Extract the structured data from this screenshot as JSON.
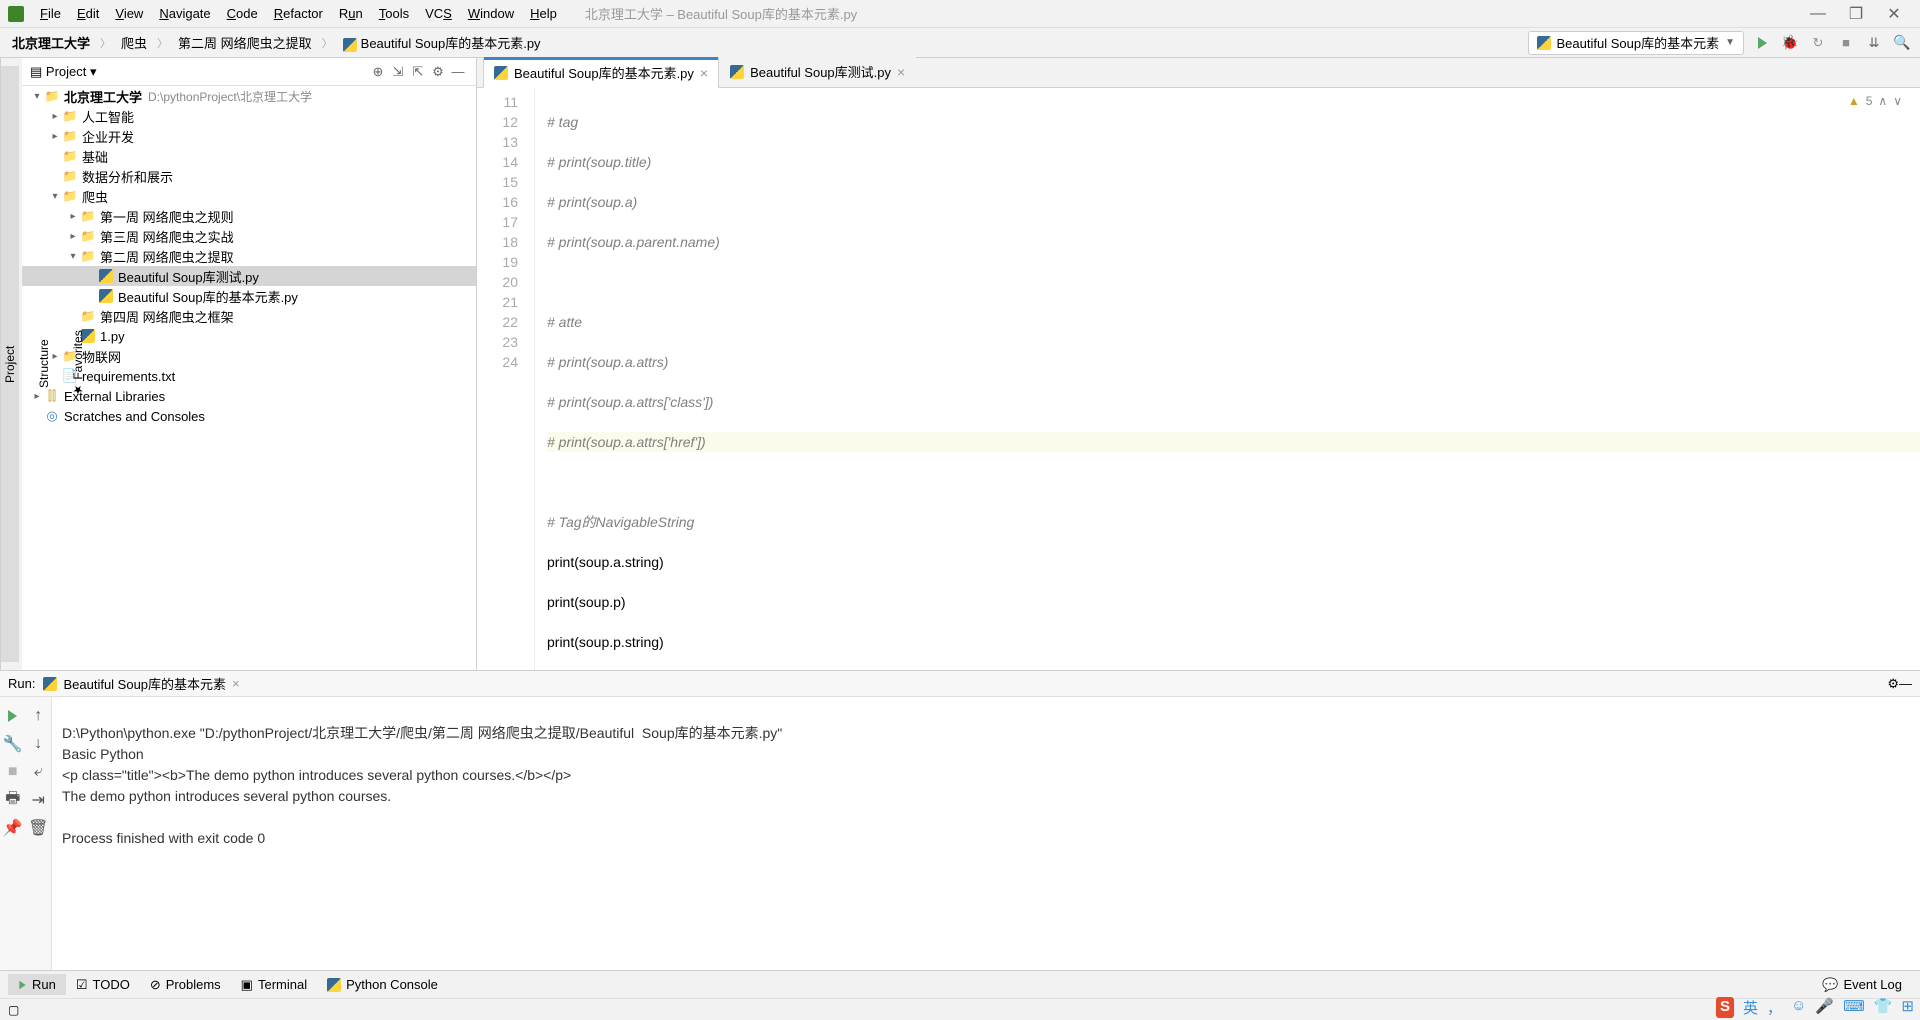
{
  "window": {
    "title": "北京理工大学 – Beautiful  Soup库的基本元素.py",
    "minimize": "—",
    "maximize": "❐",
    "close": "✕"
  },
  "menu": {
    "file": "File",
    "edit": "Edit",
    "view": "View",
    "navigate": "Navigate",
    "code": "Code",
    "refactor": "Refactor",
    "run": "Run",
    "tools": "Tools",
    "vcs": "VCS",
    "window": "Window",
    "help": "Help"
  },
  "breadcrumb": {
    "b0": "北京理工大学",
    "b1": "爬虫",
    "b2": "第二周 网络爬虫之提取",
    "b3": "Beautiful  Soup库的基本元素.py"
  },
  "run_config": {
    "label": "Beautiful  Soup库的基本元素"
  },
  "left_rail": {
    "project": "Project",
    "structure": "Structure",
    "favorites": "Favorites"
  },
  "project_panel": {
    "title": "Project"
  },
  "tree": {
    "root": "北京理工大学",
    "root_path": "D:\\pythonProject\\北京理工大学",
    "n0": "人工智能",
    "n1": "企业开发",
    "n2": "基础",
    "n3": "数据分析和展示",
    "n4": "爬虫",
    "n4a": "第一周 网络爬虫之规则",
    "n4b": "第三周 网络爬虫之实战",
    "n4c": "第二周 网络爬虫之提取",
    "n4c1": "Beautiful Soup库测试.py",
    "n4c2": "Beautiful  Soup库的基本元素.py",
    "n4d": "第四周 网络爬虫之框架",
    "n4e": "1.py",
    "n5": "物联网",
    "n6": "requirements.txt",
    "ext": "External Libraries",
    "scratch": "Scratches and Consoles"
  },
  "tabs": {
    "t0": "Beautiful  Soup库的基本元素.py",
    "t1": "Beautiful Soup库测试.py"
  },
  "editor": {
    "warnings": "5",
    "lines": {
      "l11": "11",
      "c11": "# tag",
      "l12": "12",
      "c12": "# print(soup.title)",
      "l13": "13",
      "c13": "# print(soup.a)",
      "l14": "14",
      "c14": "# print(soup.a.parent.name)",
      "l15": "15",
      "c15": "",
      "l16": "16",
      "c16": "# atte",
      "l17": "17",
      "c17": "# print(soup.a.attrs)",
      "l18": "18",
      "c18": "# print(soup.a.attrs['class'])",
      "l19": "19",
      "c19": "# print(soup.a.attrs['href'])",
      "l20": "20",
      "c20": "",
      "l21": "21",
      "c21": "# Tag的NavigableString",
      "l22": "22",
      "c22_a": "print",
      "c22_b": "(soup.a.string)",
      "l23": "23",
      "c23_a": "print",
      "c23_b": "(soup.p)",
      "l24": "24",
      "c24_a": "print",
      "c24_b": "(soup.p.string)"
    }
  },
  "run_panel": {
    "label": "Run:",
    "config": "Beautiful  Soup库的基本元素"
  },
  "console": {
    "line1": "D:\\Python\\python.exe \"D:/pythonProject/北京理工大学/爬虫/第二周 网络爬虫之提取/Beautiful  Soup库的基本元素.py\"",
    "line2": "Basic Python",
    "line3": "<p class=\"title\"><b>The demo python introduces several python courses.</b></p>",
    "line4": "The demo python introduces several python courses.",
    "line5": "",
    "line6": "Process finished with exit code 0"
  },
  "tool_tabs": {
    "run": "Run",
    "todo": "TODO",
    "problems": "Problems",
    "terminal": "Terminal",
    "pyconsole": "Python Console",
    "eventlog": "Event Log"
  },
  "tray": {
    "ime_lang": "英"
  }
}
